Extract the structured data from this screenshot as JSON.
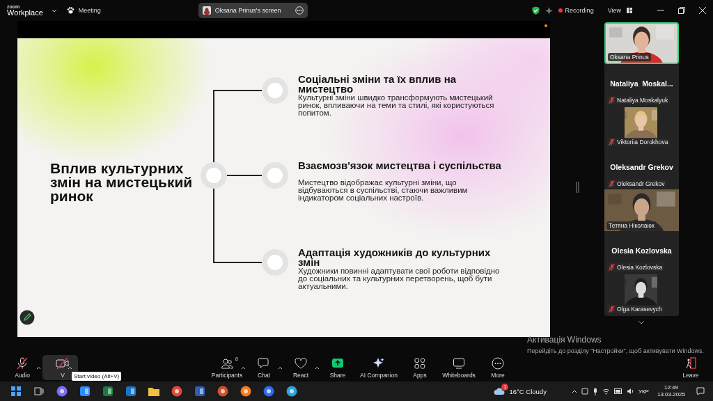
{
  "title_bar": {
    "brand": "zoom",
    "product": "Workplace",
    "meeting": "Meeting",
    "share_tab": "Oksana Prinus's screen",
    "recording": "Recording",
    "view": "View"
  },
  "slide": {
    "title": "Вплив культурних змін на мистецький ринок",
    "points": [
      {
        "heading": "Соціальні зміни та їх вплив на мистецтво",
        "text": "Культурні зміни швидко трансформують мистецький ринок, впливаючи на теми та стилі, які користуються попитом."
      },
      {
        "heading": "Взаємозв'язок мистецтва і суспільства",
        "text": "Мистецтво відображає культурні зміни, що відбуваються в суспільстві, стаючи важливим індикатором соціальних настроїв."
      },
      {
        "heading": "Адаптація художників до культурних змін",
        "text": "Художники повинні адаптувати свої роботи відповідно до соціальних та культурних перетворень, щоб бути актуальними."
      }
    ]
  },
  "participants": [
    {
      "kind": "video",
      "name": "Oksana Prinus",
      "muted": false,
      "active": true
    },
    {
      "kind": "name",
      "display": "Nataliya  Moskal...",
      "name": "Nataliya Moskalyuk",
      "muted": true,
      "active": false
    },
    {
      "name": "Viktoriia Dorokhova",
      "muted": true,
      "active": false
    },
    {
      "kind": "name",
      "display": "Oleksandr Grekov",
      "name": "Oleksandr Grekov",
      "muted": true,
      "active": false
    },
    {
      "kind": "video",
      "name": "Тетяна Ніколаюк",
      "muted": false,
      "active": false
    },
    {
      "kind": "name",
      "display": "Olesia Kozlovska",
      "name": "Olesia Kozlovska",
      "muted": true,
      "active": false
    },
    {
      "name": "Olga Karasevych",
      "muted": true,
      "active": false
    }
  ],
  "toolbar": [
    {
      "kind": "audio",
      "label": "Audio",
      "off": true,
      "menu": true,
      "hovered": false
    },
    {
      "kind": "video",
      "label": "V",
      "off": true,
      "menu": true,
      "hovered": true
    },
    {
      "kind": "participants",
      "label": "Participants",
      "count": "8",
      "off": false,
      "menu": true,
      "hovered": false
    },
    {
      "kind": "chat",
      "label": "Chat",
      "off": false,
      "menu": true,
      "hovered": false
    },
    {
      "kind": "react",
      "label": "React",
      "off": false,
      "menu": true,
      "hovered": false
    },
    {
      "kind": "share",
      "label": "Share",
      "off": false,
      "menu": false,
      "hovered": false
    },
    {
      "kind": "ai",
      "label": "AI Companion",
      "off": false,
      "menu": false,
      "hovered": false
    },
    {
      "kind": "apps",
      "label": "Apps",
      "off": false,
      "menu": false,
      "hovered": false
    },
    {
      "kind": "whiteboards",
      "label": "Whiteboards",
      "off": false,
      "menu": false,
      "hovered": false
    },
    {
      "kind": "more",
      "label": "More",
      "off": false,
      "menu": false,
      "hovered": false
    },
    {
      "kind": "leave",
      "label": "Leave",
      "off": false,
      "menu": false,
      "hovered": false
    }
  ],
  "tooltip": "Start video (Alt+V)",
  "activation": {
    "title": "Активація Windows",
    "text": "Перейдіть до розділу \"Настройки\", щоб активувати Windows."
  },
  "taskbar": {
    "weather_badge": "1",
    "weather": "16°C Cloudy",
    "language": "УКР",
    "time": "12:49",
    "date": "13.03.2025"
  }
}
